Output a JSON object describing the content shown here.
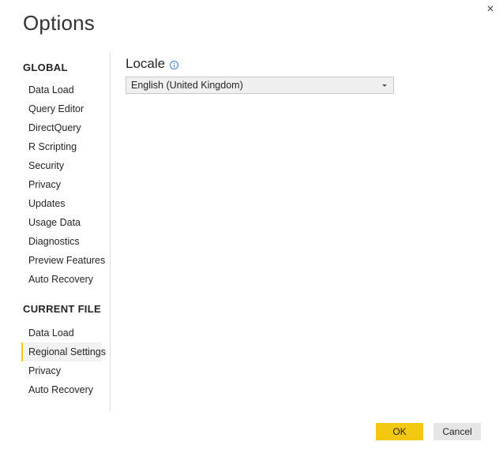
{
  "dialog": {
    "title": "Options",
    "close_glyph": "×"
  },
  "nav": {
    "global_heading": "GLOBAL",
    "global_items": [
      "Data Load",
      "Query Editor",
      "DirectQuery",
      "R Scripting",
      "Security",
      "Privacy",
      "Updates",
      "Usage Data",
      "Diagnostics",
      "Preview Features",
      "Auto Recovery"
    ],
    "current_heading": "CURRENT FILE",
    "current_items": [
      "Data Load",
      "Regional Settings",
      "Privacy",
      "Auto Recovery"
    ],
    "selected": "Regional Settings"
  },
  "content": {
    "section_label": "Locale",
    "info_icon": "info-icon",
    "locale_value": "English (United Kingdom)"
  },
  "buttons": {
    "ok": "OK",
    "cancel": "Cancel"
  },
  "colors": {
    "accent": "#f2c811",
    "info": "#3a7bd5"
  }
}
